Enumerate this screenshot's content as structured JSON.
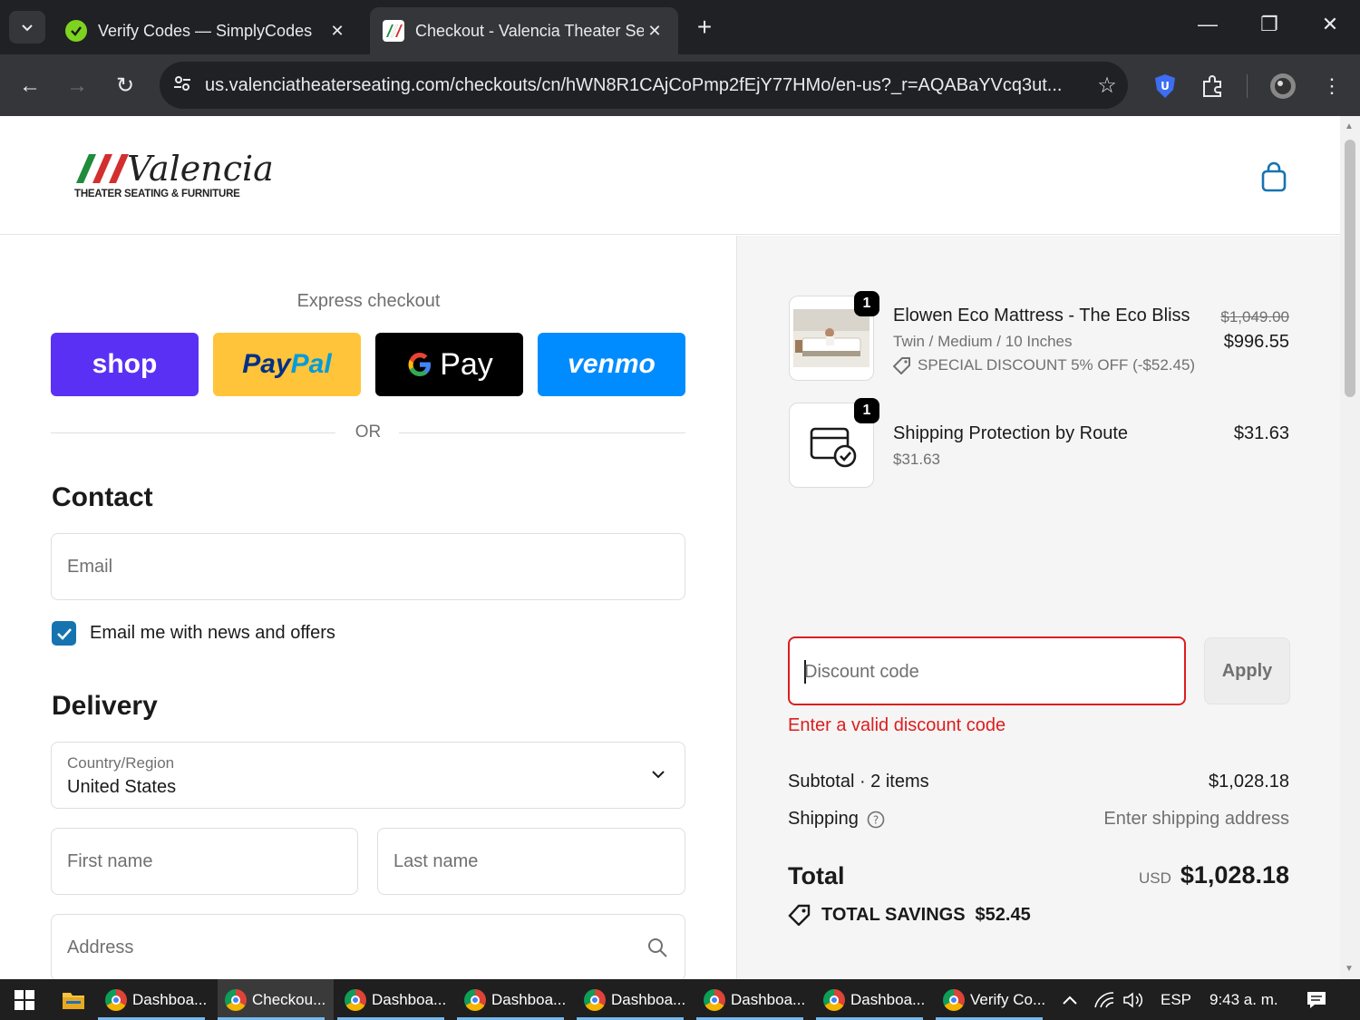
{
  "browser": {
    "tabs": [
      {
        "title": "Verify Codes — SimplyCodes",
        "active": false
      },
      {
        "title": "Checkout - Valencia Theater Se",
        "active": true
      }
    ],
    "url": "us.valenciatheaterseating.com/checkouts/cn/hWN8R1CAjCoPmp2fEjY77HMo/en-us?_r=AQABaYVcq3ut..."
  },
  "header": {
    "logo_script": "Valencia",
    "logo_tagline": "THEATER SEATING & FURNITURE"
  },
  "checkout": {
    "express_title": "Express checkout",
    "express_buttons": {
      "shop": "shop",
      "paypal_pay": "Pay",
      "paypal_pal": "Pal",
      "gpay": "Pay",
      "venmo": "venmo"
    },
    "or_label": "OR",
    "contact_heading": "Contact",
    "email_placeholder": "Email",
    "news_label": "Email me with news and offers",
    "delivery_heading": "Delivery",
    "country_label": "Country/Region",
    "country_value": "United States",
    "first_name_placeholder": "First name",
    "last_name_placeholder": "Last name",
    "address_placeholder": "Address"
  },
  "summary": {
    "items": [
      {
        "qty": "1",
        "name": "Elowen Eco Mattress - The Eco Bliss",
        "variant": "Twin / Medium / 10 Inches",
        "discount": "SPECIAL DISCOUNT 5% OFF (-$52.45)",
        "original_price": "$1,049.00",
        "price": "$996.55"
      },
      {
        "qty": "1",
        "name": "Shipping Protection by Route",
        "variant": "$31.63",
        "price": "$31.63"
      }
    ],
    "discount_placeholder": "Discount code",
    "apply_label": "Apply",
    "discount_error": "Enter a valid discount code",
    "subtotal_label": "Subtotal · 2 items",
    "subtotal_value": "$1,028.18",
    "shipping_label": "Shipping",
    "shipping_value": "Enter shipping address",
    "total_label": "Total",
    "currency": "USD",
    "total_value": "$1,028.18",
    "savings_label": "TOTAL SAVINGS",
    "savings_value": "$52.45"
  },
  "taskbar": {
    "items": [
      {
        "label": "Dashboa...",
        "active": false
      },
      {
        "label": "Checkou...",
        "active": true
      },
      {
        "label": "Dashboa...",
        "active": false
      },
      {
        "label": "Dashboa...",
        "active": false
      },
      {
        "label": "Dashboa...",
        "active": false
      },
      {
        "label": "Dashboa...",
        "active": false
      },
      {
        "label": "Dashboa...",
        "active": false
      },
      {
        "label": "Verify Co...",
        "active": false
      }
    ],
    "language": "ESP",
    "time": "9:43 a. m."
  },
  "colors": {
    "shop": "#5a31f4",
    "paypal": "#ffc439",
    "gpay": "#000000",
    "venmo": "#008cff",
    "link": "#1773b0",
    "error": "#dd1d1d"
  }
}
